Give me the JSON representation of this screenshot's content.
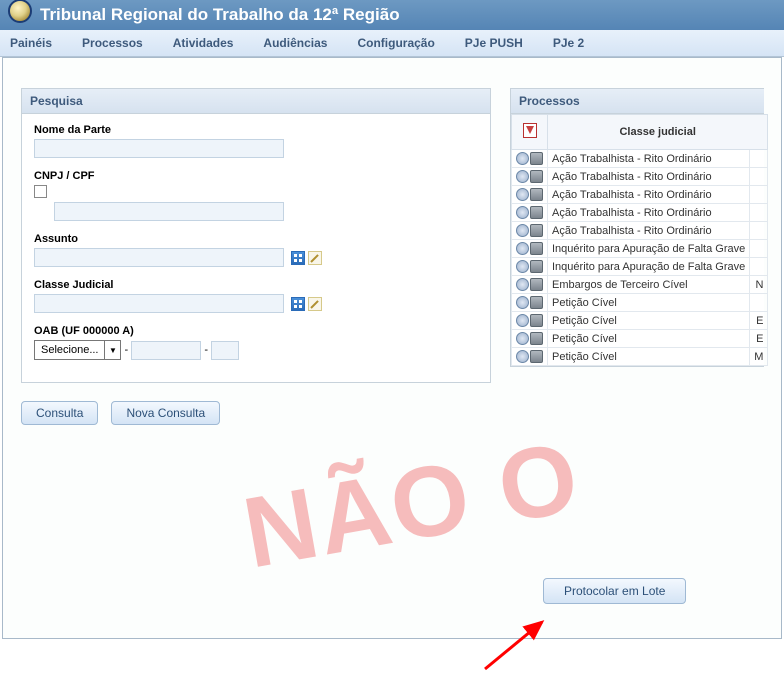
{
  "header": {
    "title": "Tribunal Regional do Trabalho da 12ª Região"
  },
  "menu": {
    "items": [
      "Painéis",
      "Processos",
      "Atividades",
      "Audiências",
      "Configuração",
      "PJe PUSH",
      "PJe 2"
    ]
  },
  "search": {
    "panel_title": "Pesquisa",
    "nome_label": "Nome da Parte",
    "nome_value": "",
    "cnpj_label": "CNPJ / CPF",
    "cnpj_value": "",
    "assunto_label": "Assunto",
    "assunto_value": "",
    "classe_label": "Classe Judicial",
    "classe_value": "",
    "oab_label": "OAB (UF 000000 A)",
    "oab_select": "Selecione...",
    "oab_num": "",
    "oab_letter": "",
    "btn_consulta": "Consulta",
    "btn_nova": "Nova Consulta"
  },
  "processos": {
    "panel_title": "Processos",
    "col_classe": "Classe judicial",
    "rows": [
      {
        "classe": "Ação Trabalhista - Rito Ordinário",
        "r": ""
      },
      {
        "classe": "Ação Trabalhista - Rito Ordinário",
        "r": ""
      },
      {
        "classe": "Ação Trabalhista - Rito Ordinário",
        "r": ""
      },
      {
        "classe": "Ação Trabalhista - Rito Ordinário",
        "r": ""
      },
      {
        "classe": "Ação Trabalhista - Rito Ordinário",
        "r": ""
      },
      {
        "classe": "Inquérito para Apuração de Falta Grave",
        "r": ""
      },
      {
        "classe": "Inquérito para Apuração de Falta Grave",
        "r": ""
      },
      {
        "classe": "Embargos de Terceiro Cível",
        "r": "N"
      },
      {
        "classe": "Petição Cível",
        "r": ""
      },
      {
        "classe": "Petição Cível",
        "r": "E"
      },
      {
        "classe": "Petição Cível",
        "r": "E"
      },
      {
        "classe": "Petição Cível",
        "r": "M"
      }
    ],
    "btn_protocolar": "Protocolar em Lote"
  },
  "watermark": "NÃO O"
}
